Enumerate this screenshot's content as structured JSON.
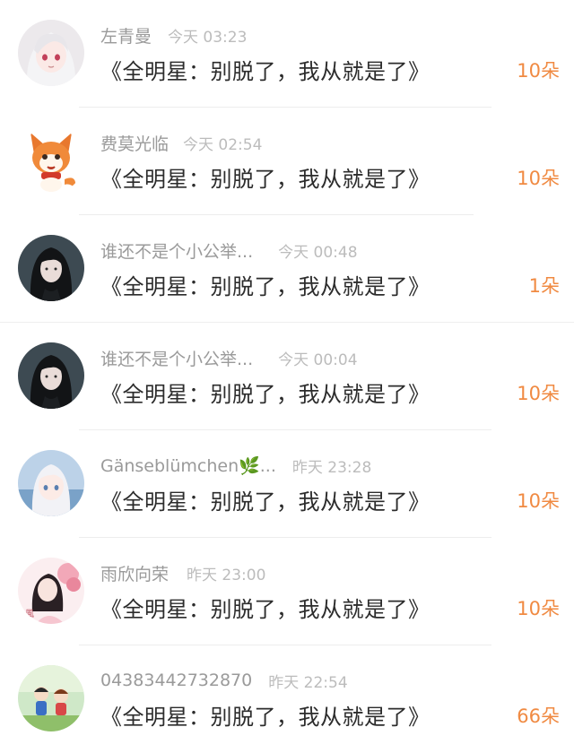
{
  "comments": [
    {
      "username": "左青曼",
      "time": "今天 03:23",
      "message": "《全明星：别脱了，我从就是了》",
      "flowers": "10朵",
      "avatar": "anime-girl-white-hair-avatar"
    },
    {
      "username": "费莫光临",
      "time": "今天 02:54",
      "message": "《全明星：别脱了，我从就是了》",
      "flowers": "10朵",
      "avatar": "cartoon-fox-avatar"
    },
    {
      "username": "谁还不是个小公举...",
      "time": "今天 00:48",
      "message": "《全明星：别脱了，我从就是了》",
      "flowers": "1朵",
      "avatar": "dark-haired-girl-avatar"
    },
    {
      "username": "谁还不是个小公举...",
      "time": "今天 00:04",
      "message": "《全明星：别脱了，我从就是了》",
      "flowers": "10朵",
      "avatar": "dark-haired-girl-avatar"
    },
    {
      "username": "Gänseblümchen🌿...",
      "time": "昨天 23:28",
      "message": "《全明星：别脱了，我从就是了》",
      "flowers": "10朵",
      "avatar": "anime-girl-blue-avatar"
    },
    {
      "username": "雨欣向荣",
      "time": "昨天 23:00",
      "message": "《全明星：别脱了，我从就是了》",
      "flowers": "10朵",
      "avatar": "pink-flower-girl-avatar"
    },
    {
      "username": "04383442732870",
      "time": "昨天 22:54",
      "message": "《全明星：别脱了，我从就是了》",
      "flowers": "66朵",
      "avatar": "cartoon-kids-avatar"
    }
  ],
  "colors": {
    "username": "#9a9a9a",
    "time": "#bcbcbc",
    "message": "#2c2c2c",
    "flowers": "#f08a42"
  }
}
